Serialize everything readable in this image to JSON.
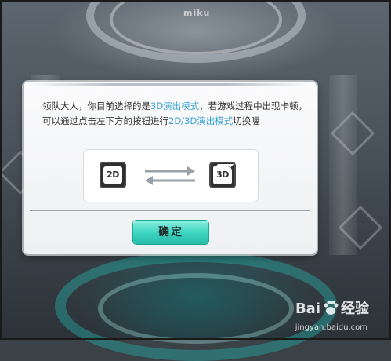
{
  "background": {
    "brand_text": "miku"
  },
  "dialog": {
    "message_part1": "领队大人，你目前选择的是",
    "highlight1": "3D演出模式",
    "message_part2": "，若游戏过程中出现卡顿，可以通过点击左下方的按钮进行",
    "highlight2": "2D/3D演出模式",
    "message_part3": "切换喔",
    "left_mode_label": "2D",
    "right_mode_label": "3D",
    "confirm_label": "确定",
    "highlight_color": "#3aa3d8",
    "button_color": "#3fd6c2"
  },
  "watermark": {
    "brand_left": "Bai",
    "brand_right": "经验",
    "url": "jingyan.baidu.com"
  }
}
